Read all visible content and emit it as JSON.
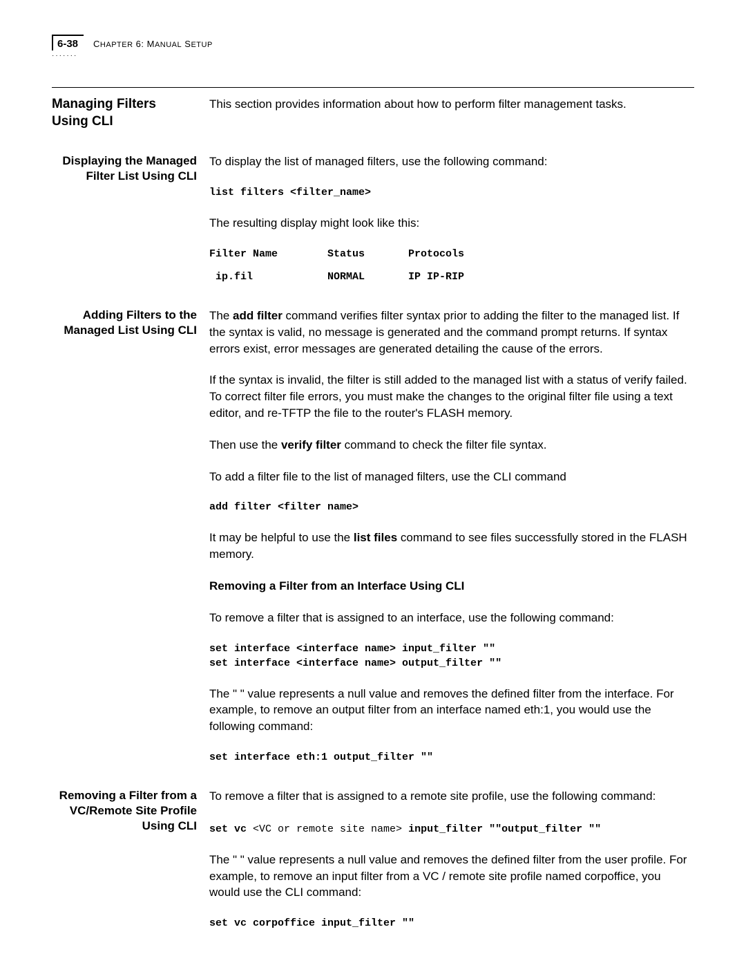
{
  "header": {
    "page_number": "6-38",
    "chapter_prefix": "C",
    "chapter_word": "HAPTER",
    "chapter_num": " 6: M",
    "chapter_rest": "ANUAL",
    "chapter_tail": " S",
    "chapter_tail2": "ETUP"
  },
  "s1": {
    "title_l1": "Managing Filters",
    "title_l2": "Using CLI",
    "intro": "This section provides information about how to perform filter management tasks."
  },
  "s2": {
    "title_l1": "Displaying the Managed",
    "title_l2": "Filter List Using CLI",
    "p1": "To display the list of managed filters, use the following command:",
    "code1": "list filters <filter_name>",
    "p2": "The resulting display might look like this:",
    "table_head": "Filter Name        Status       Protocols",
    "table_row": " ip.fil            NORMAL       IP IP-RIP"
  },
  "s3": {
    "title_l1": "Adding Filters to the",
    "title_l2": "Managed List Using CLI",
    "p1_a": "The ",
    "p1_b": "add filter",
    "p1_c": " command verifies filter syntax prior to adding the filter to the managed list. If the syntax is valid, no message is generated and the command prompt returns. If syntax errors exist, error messages are generated detailing the cause of the errors.",
    "p2": "If the syntax is invalid, the filter is still added to the managed list with a status of verify failed. To correct filter file errors, you must make the changes to the original filter file using a text editor, and re-TFTP the file to the router's FLASH memory.",
    "p3_a": "Then use the ",
    "p3_b": "verify filter",
    "p3_c": " command to check the filter file syntax.",
    "p4": "To add a filter file to the list of managed filters, use the CLI command",
    "code1": "add filter <filter name>",
    "p5_a": "It may be helpful to use the ",
    "p5_b": "list files",
    "p5_c": " command to see files successfully stored in the FLASH memory.",
    "sub_heading": "Removing a Filter from an Interface Using CLI",
    "p6": "To remove a filter that is assigned to an interface, use the following command:",
    "code2": "set interface <interface name> input_filter \"\"\nset interface <interface name> output_filter \"\"",
    "p7": "The \" \" value represents a null value and removes the defined filter from the interface. For example, to remove an output filter from an interface named eth:1, you would use the following command:",
    "code3": "set interface eth:1 output_filter \"\""
  },
  "s4": {
    "title_l1": "Removing a Filter from a",
    "title_l2": "VC/Remote Site Profile",
    "title_l3": "Using CLI",
    "p1": "To remove a filter that is assigned to a remote site profile, use the following command:",
    "code1_a": "set vc ",
    "code1_b": "<VC or remote site name>",
    "code1_c": " input_filter \"\"output_filter \"\"",
    "p2": "The \" \" value represents a null value and removes the defined filter from the user profile. For example, to remove an input filter from a VC / remote site profile named corpoffice, you would use the CLI command:",
    "code2": "set vc corpoffice input_filter \"\""
  }
}
